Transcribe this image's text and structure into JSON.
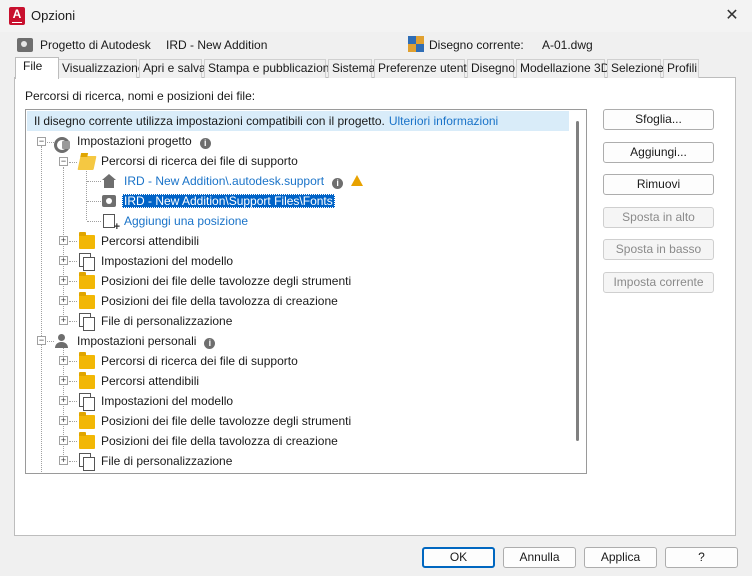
{
  "window": {
    "title": "Opzioni",
    "app_icon_letter": "A",
    "close_glyph": "✕"
  },
  "header": {
    "project_label": "Progetto di Autodesk",
    "project_name": "IRD - New Addition",
    "drawing_label": "Disegno corrente:",
    "drawing_name": "A-01.dwg"
  },
  "tabs": [
    {
      "label": "File",
      "active": true
    },
    {
      "label": "Visualizzazione"
    },
    {
      "label": "Apri e salva"
    },
    {
      "label": "Stampa e pubblicazione"
    },
    {
      "label": "Sistema"
    },
    {
      "label": "Preferenze utente"
    },
    {
      "label": "Disegno"
    },
    {
      "label": "Modellazione 3D"
    },
    {
      "label": "Selezione"
    },
    {
      "label": "Profili"
    }
  ],
  "section_label": "Percorsi di ricerca, nomi e posizioni dei file:",
  "info_bar": {
    "text": "Il disegno corrente utilizza impostazioni compatibili con il progetto.",
    "link": "Ulteriori informazioni"
  },
  "tree": {
    "project_settings": "Impostazioni progetto",
    "project_children": [
      "Percorsi di ricerca dei file di supporto",
      "Percorsi attendibili",
      "Impostazioni del modello",
      "Posizioni dei file delle tavolozze degli strumenti",
      "Posizioni dei file della tavolozza di creazione",
      "File di personalizzazione"
    ],
    "support_paths": [
      "IRD - New Addition\\.autodesk.support",
      "IRD - New Addition\\Support Files\\Fonts"
    ],
    "add_location": "Aggiungi una posizione",
    "personal_settings": "Impostazioni personali",
    "personal_children": [
      "Percorsi di ricerca dei file di supporto",
      "Percorsi attendibili",
      "Impostazioni del modello",
      "Posizioni dei file delle tavolozze degli strumenti",
      "Posizioni dei file della tavolozza di creazione",
      "File di personalizzazione"
    ]
  },
  "side_buttons": [
    {
      "label": "Sfoglia...",
      "enabled": true
    },
    {
      "label": "Aggiungi...",
      "enabled": true
    },
    {
      "label": "Rimuovi",
      "enabled": true
    },
    {
      "label": "Sposta in alto",
      "enabled": false
    },
    {
      "label": "Sposta in basso",
      "enabled": false
    },
    {
      "label": "Imposta corrente",
      "enabled": false
    }
  ],
  "bottom_buttons": {
    "ok": "OK",
    "cancel": "Annulla",
    "apply": "Applica",
    "help": "?"
  },
  "colors": {
    "accent": "#0063c7",
    "link": "#1a73c8",
    "info_bg": "#d9ecf9",
    "warning": "#e8a200",
    "app_red": "#c8102e"
  },
  "icons": {
    "project": "camera-icon",
    "drawing": "dwg-file-icon",
    "project_settings": "gear-project-icon",
    "personal_settings": "person-settings-icon",
    "folder": "folder-icon",
    "pages": "pages-icon",
    "home": "home-folder-icon",
    "warning": "warning-icon",
    "info": "info-icon",
    "add": "add-location-icon"
  }
}
